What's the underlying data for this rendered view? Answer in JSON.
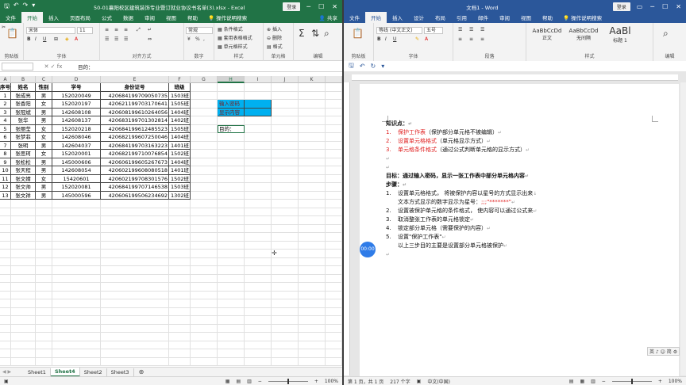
{
  "excel": {
    "title": "50-01襄阳校区建筑装饰专业暨订就业协议书名单(3).xlsx  -  Excel",
    "login_label": "登录",
    "tabs": [
      "文件",
      "开始",
      "插入",
      "页面布局",
      "公式",
      "数据",
      "审阅",
      "视图",
      "帮助"
    ],
    "active_tab": "开始",
    "tell_me": "操作说明搜索",
    "share": "共享",
    "ribbon": {
      "font_name": "宋体",
      "font_size": "11",
      "number_format": "常规",
      "groups": [
        "剪贴板",
        "字体",
        "对齐方式",
        "数字",
        "样式",
        "单元格",
        "编辑"
      ],
      "style_items": [
        "条件格式",
        "套用表格格式",
        "单元格样式"
      ],
      "cell_items": [
        "插入",
        "删除",
        "格式"
      ],
      "percent": "%",
      "comma": ","
    },
    "formula_bar": {
      "fx": "fx",
      "content": "目的："
    },
    "columns": [
      "A",
      "B",
      "C",
      "D",
      "E",
      "F",
      "G",
      "H",
      "I",
      "J",
      "K"
    ],
    "selected_column": "H",
    "headers": [
      "序号",
      "姓名",
      "性别",
      "学号",
      "身份证号",
      "班级"
    ],
    "rows": [
      [
        "1",
        "张成亮",
        "男",
        "152020049",
        "420684199709050735",
        "1503班"
      ],
      [
        "2",
        "张香阳",
        "女",
        "152020197",
        "420621199703170641",
        "1505班"
      ],
      [
        "3",
        "张冠斌",
        "男",
        "142608108",
        "420608199610264056",
        "1404班"
      ],
      [
        "4",
        "张华",
        "男",
        "142608137",
        "420683199701302814",
        "1402班"
      ],
      [
        "5",
        "张丽莹",
        "女",
        "152020218",
        "420684199612485523",
        "1505班"
      ],
      [
        "6",
        "张梦菲",
        "女",
        "142608046",
        "420682199607250046",
        "1404班"
      ],
      [
        "7",
        "张明",
        "男",
        "142604037",
        "420684199703163223",
        "1401班"
      ],
      [
        "8",
        "张思珂",
        "女",
        "152020001",
        "420682199710076854",
        "1502班"
      ],
      [
        "9",
        "张松松",
        "男",
        "145000606",
        "420606199605267673",
        "1404班"
      ],
      [
        "10",
        "张天程",
        "男",
        "142608054",
        "420602199608080518",
        "1401班"
      ],
      [
        "11",
        "张文婧",
        "女",
        "15420601",
        "420602199708301576",
        "1502班"
      ],
      [
        "12",
        "张文帅",
        "男",
        "152020081",
        "420684199707146538",
        "1503班"
      ],
      [
        "13",
        "张文祥",
        "男",
        "145000596",
        "420606199506234692",
        "1302班"
      ]
    ],
    "side_cells": {
      "input_label": "输入密码",
      "display_label": "显示内容",
      "goal_label": "目的："
    },
    "sheets": [
      "Sheet1",
      "Sheet4",
      "Sheet2",
      "Sheet3"
    ],
    "active_sheet": "Sheet4",
    "zoom": "100%",
    "accent": "#217346"
  },
  "word": {
    "title": "文档1  -  Word",
    "login_label": "登录",
    "tabs": [
      "文件",
      "开始",
      "插入",
      "设计",
      "布局",
      "引用",
      "邮件",
      "审阅",
      "视图",
      "帮助"
    ],
    "active_tab": "开始",
    "tell_me": "操作说明搜索",
    "ribbon": {
      "font_name": "等线 (中文正文)",
      "font_size": "五号",
      "groups": [
        "剪贴板",
        "字体",
        "段落",
        "样式",
        "编辑"
      ],
      "styles": [
        {
          "preview": "AaBbCcDd",
          "name": "正文"
        },
        {
          "preview": "AaBbCcDd",
          "name": "无间隔"
        },
        {
          "preview": "AaBl",
          "name": "标题 1"
        }
      ]
    },
    "doc": {
      "knowledge_title": "知识点：",
      "knowledge": [
        {
          "n": "1.",
          "hl": "保护工作表",
          "rest": "（保护部分单元格不被编辑）"
        },
        {
          "n": "2.",
          "hl": "设置单元格格式",
          "rest": "（单元格显示方式）"
        },
        {
          "n": "3.",
          "hl": "单元格条件格式",
          "rest": "（通过公式判断单元格的显示方式）"
        }
      ],
      "goal": "目标：通过输入密码，显示一张工作表中部分单元格内容",
      "steps_title": "步骤：",
      "step1": "设置单元格格式，  将被保护内容以星号的方式显示出来",
      "step1_cont_a": "文本方式显示的数字显示为星号：",
      "step1_cont_b": ";;;\"*******\"",
      "step2": "设置被保护单元格的条件格式，  使内容可以通过公式来",
      "step3": "取消整张工作表的单元格锁定",
      "step4": "锁定部分单元格（需要保护的内容）",
      "step5": "设置\"保护工作表\"",
      "step5_cont": "以上三步目的主要是设置部分单元格被保护",
      "nums": [
        "1.",
        "2.",
        "3.",
        "4.",
        "5."
      ]
    },
    "badge": "00:00",
    "ime": "英 ♪ ☺ 简 ⚙",
    "status": {
      "page": "第 1 页，共 1 页",
      "words": "217 个字",
      "lang": "中文(中国)",
      "zoom": "100%"
    },
    "accent": "#2b579a"
  }
}
